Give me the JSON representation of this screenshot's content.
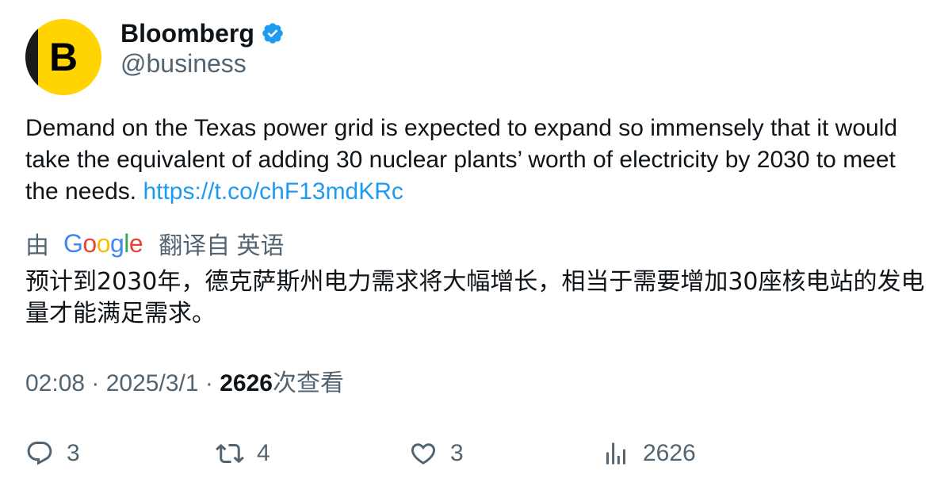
{
  "author": {
    "avatar_letter": "B",
    "display_name": "Bloomberg",
    "handle": "@business",
    "verified_icon": "verified-badge-icon"
  },
  "tweet": {
    "text": "Demand on the Texas power grid is expected to expand so immensely that it would take the equivalent of adding 30 nuclear plants’ worth of electricity by 2030 to meet the needs. ",
    "link": "https://t.co/chF13mdKRc"
  },
  "translation": {
    "by_label": "由",
    "provider": "Google",
    "from_label": "翻译自 英语",
    "text": "预计到2030年，德克萨斯州电力需求将大幅增长，相当于需要增加30座核电站的发电量才能满足需求。"
  },
  "meta": {
    "time": "02:08",
    "separator": " · ",
    "date": "2025/3/1",
    "views": "2626",
    "views_label": "次查看"
  },
  "actions": {
    "replies": "3",
    "retweets": "4",
    "likes": "3",
    "views": "2626"
  },
  "colors": {
    "link": "#1d9bf0",
    "secondary_text": "#536471",
    "primary_text": "#0f1419",
    "avatar_bg": "#ffd400",
    "verified": "#1d9bf0"
  }
}
